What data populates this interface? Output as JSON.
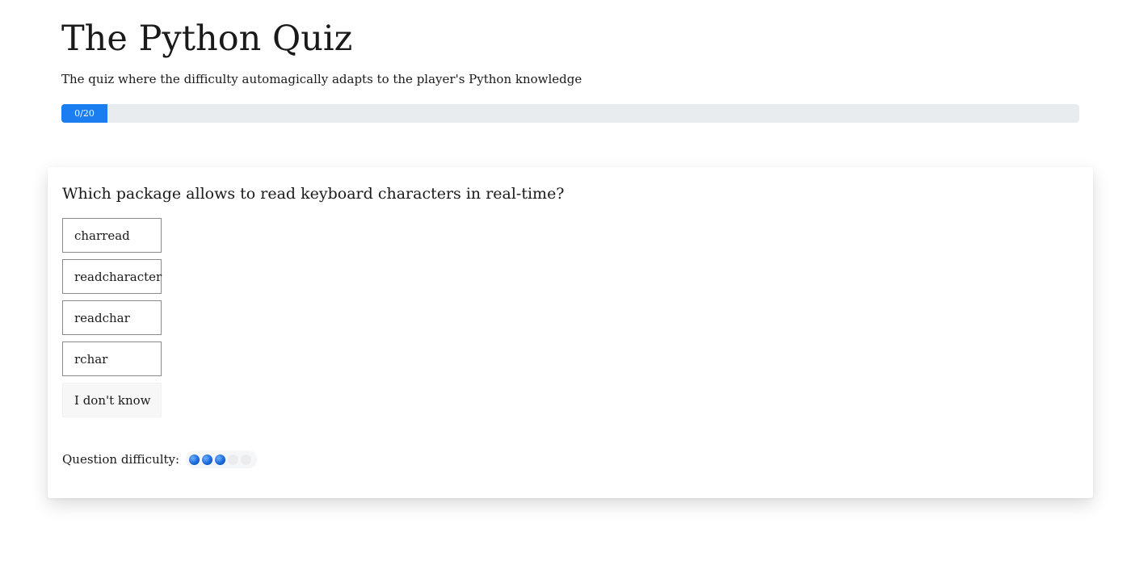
{
  "header": {
    "title": "The Python Quiz",
    "subtitle": "The quiz where the difficulty automagically adapts to the player's Python knowledge"
  },
  "progress": {
    "label": "0/20",
    "current": 0,
    "total": 20,
    "color": "#1a7df0"
  },
  "question": {
    "text": "Which package allows to read keyboard characters in real-time?",
    "options": [
      {
        "label": "charread"
      },
      {
        "label": "readcharacter"
      },
      {
        "label": "readchar"
      },
      {
        "label": "rchar"
      }
    ],
    "unknown_label": "I don't know"
  },
  "difficulty": {
    "label": "Question difficulty:",
    "level": 3,
    "max": 5,
    "dot_color": "#1565d8"
  }
}
